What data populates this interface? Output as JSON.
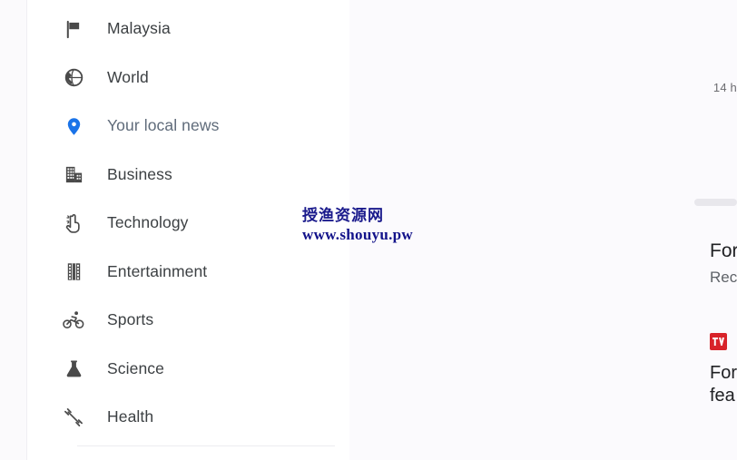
{
  "sidebar": {
    "items": [
      {
        "label": "Malaysia",
        "icon": "flag-icon",
        "active": false
      },
      {
        "label": "World",
        "icon": "globe-icon",
        "active": false
      },
      {
        "label": "Your local news",
        "icon": "location-pin-icon",
        "active": true
      },
      {
        "label": "Business",
        "icon": "building-icon",
        "active": false
      },
      {
        "label": "Technology",
        "icon": "tech-hand-icon",
        "active": false
      },
      {
        "label": "Entertainment",
        "icon": "film-strip-icon",
        "active": false
      },
      {
        "label": "Sports",
        "icon": "bicycle-icon",
        "active": false
      },
      {
        "label": "Science",
        "icon": "flask-icon",
        "active": false
      },
      {
        "label": "Health",
        "icon": "dumbbell-icon",
        "active": false
      }
    ]
  },
  "content": {
    "timestamp": "14 h",
    "story_primary": {
      "headline": "For",
      "subhead": "Rec"
    },
    "story_secondary": {
      "publisher_logo": "tv-red-logo-icon",
      "headline_line1": "For",
      "headline_line2": "fea"
    }
  },
  "watermark": {
    "chinese": "授渔资源网",
    "url": "www.shouyu.pw"
  },
  "colors": {
    "accent_blue": "#1a73e8",
    "active_label": "#5f6b7a",
    "icon_gray": "#4a4a4a",
    "text_primary": "#3c4043",
    "content_bg": "#fbfafd",
    "scrollbar_thumb": "#cfcfd4",
    "publisher_red": "#d8232a",
    "watermark_blue": "#12128a"
  }
}
